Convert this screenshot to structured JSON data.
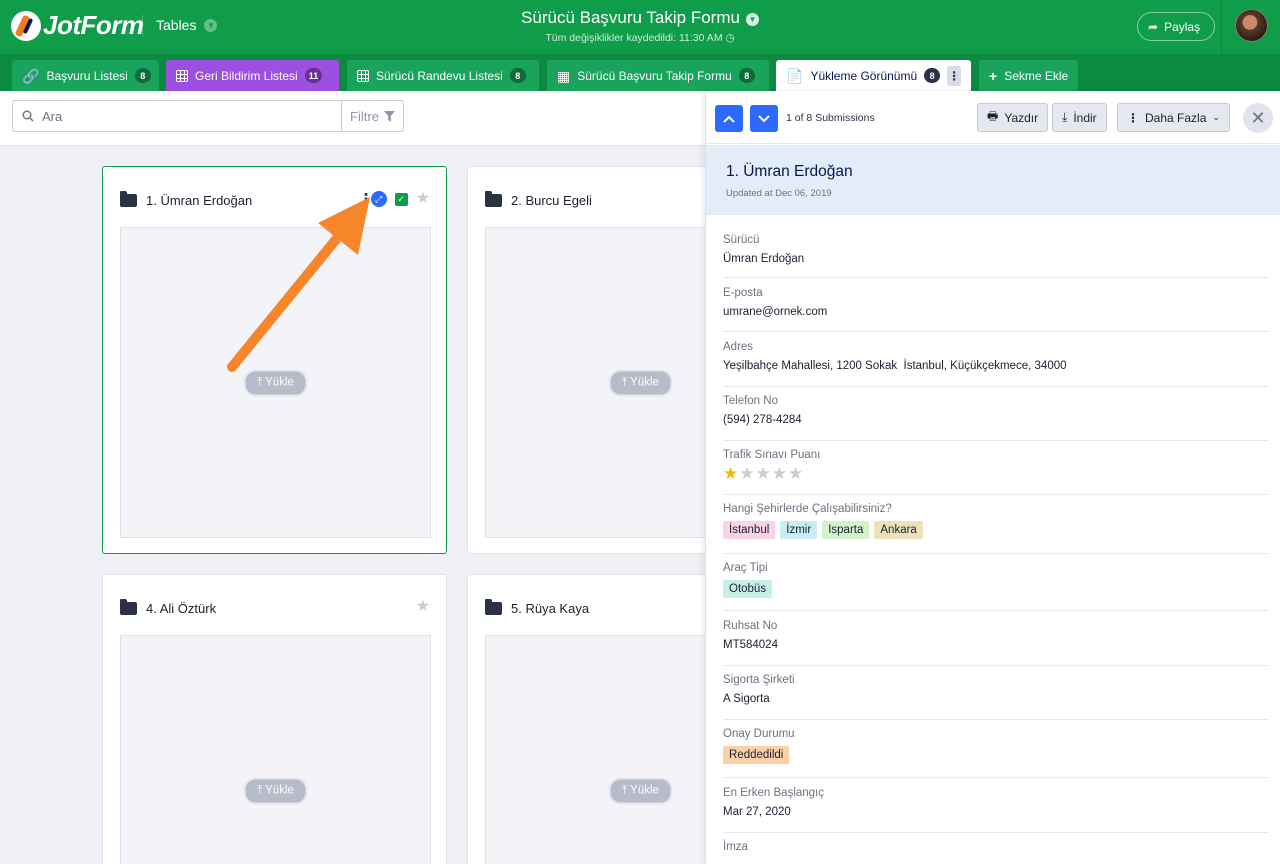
{
  "header": {
    "brand": "JotForm",
    "section": "Tables",
    "form_title": "Sürücü Başvuru Takip Formu",
    "saved_status": "Tüm değişiklikler kaydedildi: 11:30 AM",
    "share_label": "Paylaş"
  },
  "tabs": [
    {
      "label": "Başvuru Listesi",
      "count": "8",
      "color": "#1aa35a",
      "icon": "link-icon"
    },
    {
      "label": "Geri Bildirim Listesi",
      "count": "11",
      "color": "#9d4fe0",
      "icon": "table-icon"
    },
    {
      "label": "Sürücü Randevu Listesi",
      "count": "8",
      "color": "#1aa35a",
      "icon": "table-icon"
    },
    {
      "label": "Sürücü Başvuru Takip Formu",
      "count": "8",
      "color": "#1aa35a",
      "icon": "chart-icon"
    },
    {
      "label": "Yükleme Görünümü",
      "count": "8",
      "color": "#ffffff",
      "icon": "file-icon"
    },
    {
      "label": "Sekme Ekle",
      "color": "#1aa35a",
      "icon": "plus-icon"
    }
  ],
  "search": {
    "placeholder": "Ara",
    "filter_label": "Filtre"
  },
  "cards": [
    {
      "title": "1. Ümran Erdoğan",
      "upload_label": "Yükle"
    },
    {
      "title": "2. Burcu Egeli",
      "upload_label": "Yükle"
    },
    {
      "title": "4. Ali Öztürk",
      "upload_label": "Yükle"
    },
    {
      "title": "5. Rüya Kaya",
      "upload_label": "Yükle"
    }
  ],
  "panel": {
    "counter": "1 of 8 Submissions",
    "print_label": "Yazdır",
    "download_label": "İndir",
    "more_label": "Daha Fazla",
    "name": "1. Ümran Erdoğan",
    "updated": "Updated at Dec 06, 2019",
    "fields": {
      "driver": {
        "label": "Sürücü",
        "value": "Ümran Erdoğan"
      },
      "email": {
        "label": "E-posta",
        "value": "umrane@ornek.com"
      },
      "address": {
        "label": "Adres",
        "value": "Yeşilbahçe Mahallesi, 1200 Sokak  İstanbul, Küçükçekmece, 34000"
      },
      "phone": {
        "label": "Telefon No",
        "value": "(594) 278-4284"
      },
      "score": {
        "label": "Trafik Sınavı Puanı",
        "rating": 1,
        "max": 5
      },
      "cities": {
        "label": "Hangi Şehirlerde Çalışabilirsiniz?",
        "tags": [
          {
            "text": "İstanbul",
            "color": "#fbd3e6"
          },
          {
            "text": "İzmir",
            "color": "#c8eef3"
          },
          {
            "text": "Isparta",
            "color": "#d3f3cd"
          },
          {
            "text": "Ankara",
            "color": "#ece1bd"
          }
        ]
      },
      "vehicle": {
        "label": "Araç Tipi",
        "tags": [
          {
            "text": "Otobüs",
            "color": "#c7efe6"
          }
        ]
      },
      "license": {
        "label": "Ruhsat No",
        "value": "MT584024"
      },
      "insurance": {
        "label": "Sigorta Şirketi",
        "value": "A Sigorta"
      },
      "approval": {
        "label": "Onay Durumu",
        "tags": [
          {
            "text": "Reddedildi",
            "color": "#fcd0a6"
          }
        ]
      },
      "start": {
        "label": "En Erken Başlangıç",
        "value": "Mar 27, 2020"
      },
      "signature": {
        "label": "İmza"
      }
    }
  },
  "colors": {
    "brand_green": "#0f9d4a",
    "accent_blue": "#2e69ff",
    "annotation_arrow": "#f7862a"
  }
}
